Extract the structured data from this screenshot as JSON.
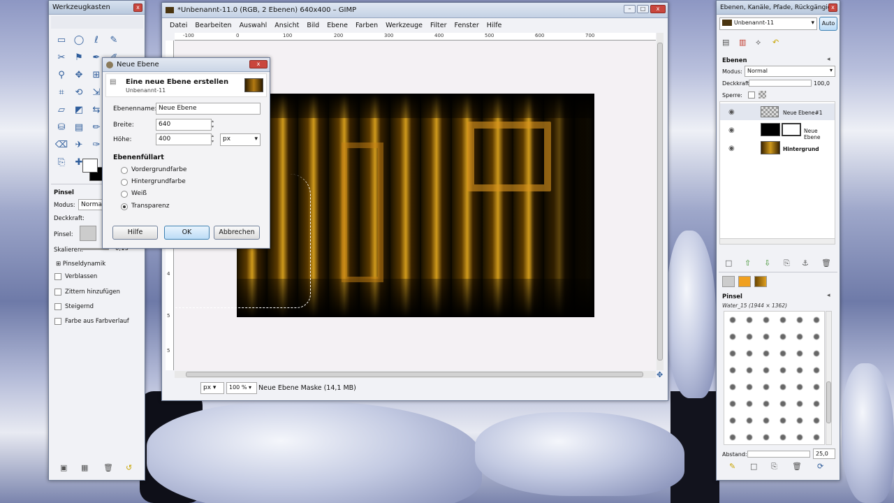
{
  "toolbox": {
    "title": "Werkzeugkasten",
    "tool_name": "Pinsel",
    "mode_label": "Modus:",
    "mode_value": "Normal",
    "opacity_label": "Deckkraft:",
    "brush_label": "Pinsel:",
    "scale_label": "Skalieren:",
    "scale_value": "0,13",
    "dynamics": "Pinseldynamik",
    "options": [
      "Verblassen",
      "Zittern hinzufügen",
      "Steigernd",
      "Farbe aus Farbverlauf"
    ]
  },
  "image_window": {
    "title": "*Unbenannt-11.0 (RGB, 2 Ebenen) 640x400 – GIMP",
    "menu": [
      "Datei",
      "Bearbeiten",
      "Auswahl",
      "Ansicht",
      "Bild",
      "Ebene",
      "Farben",
      "Werkzeuge",
      "Filter",
      "Fenster",
      "Hilfe"
    ],
    "ruler_h": [
      "-100",
      "0",
      "100",
      "200",
      "300",
      "400",
      "500",
      "600",
      "700"
    ],
    "ruler_v": [
      "1",
      "1",
      "2",
      "3",
      "3",
      "4",
      "5",
      "5"
    ],
    "unit": "px",
    "zoom": "100 %",
    "status": "Neue Ebene Maske (14,1 MB)"
  },
  "dialog": {
    "title": "Neue Ebene",
    "heading": "Eine neue Ebene erstellen",
    "subheading": "Unbenannt-11",
    "name_label": "Ebenenname:",
    "name_value": "Neue Ebene",
    "width_label": "Breite:",
    "width_value": "640",
    "height_label": "Höhe:",
    "height_value": "400",
    "unit": "px",
    "fill_title": "Ebenenfüllart",
    "fill_options": [
      "Vordergrundfarbe",
      "Hintergrundfarbe",
      "Weiß",
      "Transparenz"
    ],
    "selected_fill": "Transparenz",
    "help": "Hilfe",
    "ok": "OK",
    "cancel": "Abbrechen"
  },
  "layers": {
    "title": "Ebenen, Kanäle, Pfade, Rückgängig...",
    "image_name": "Unbenannt-11",
    "auto": "Auto",
    "panel_title": "Ebenen",
    "mode_label": "Modus:",
    "mode_value": "Normal",
    "opacity_label": "Deckkraft:",
    "opacity_value": "100,0",
    "lock_label": "Sperre:",
    "items": [
      {
        "name": "Neue Ebene#1",
        "bold": false
      },
      {
        "name": "Neue Ebene",
        "bold": false
      },
      {
        "name": "Hintergrund",
        "bold": true
      }
    ]
  },
  "brushes": {
    "panel_title": "Pinsel",
    "brush_name": "Water_15 (1944 × 1362)",
    "spacing_label": "Abstand:",
    "spacing_value": "25,0"
  }
}
